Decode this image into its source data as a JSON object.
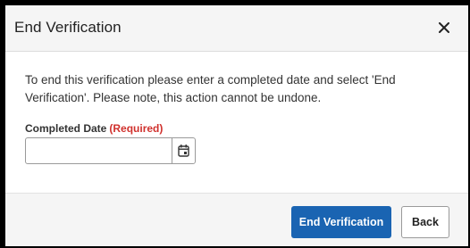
{
  "dialog": {
    "title": "End Verification",
    "close_symbol": "×",
    "message": "To end this verification please enter a completed date and select 'End Verification'. Please note, this action cannot be undone.",
    "field": {
      "label": "Completed Date",
      "required_text": "(Required)",
      "value": "",
      "placeholder": ""
    },
    "buttons": {
      "primary_label": "End Verification",
      "secondary_label": "Back"
    }
  },
  "colors": {
    "primary": "#1a64b2",
    "required": "#d0312d",
    "header_bg": "#f5f5f5",
    "border": "#9a9a9a"
  },
  "icons": {
    "close": "close-icon",
    "calendar": "calendar-icon"
  }
}
